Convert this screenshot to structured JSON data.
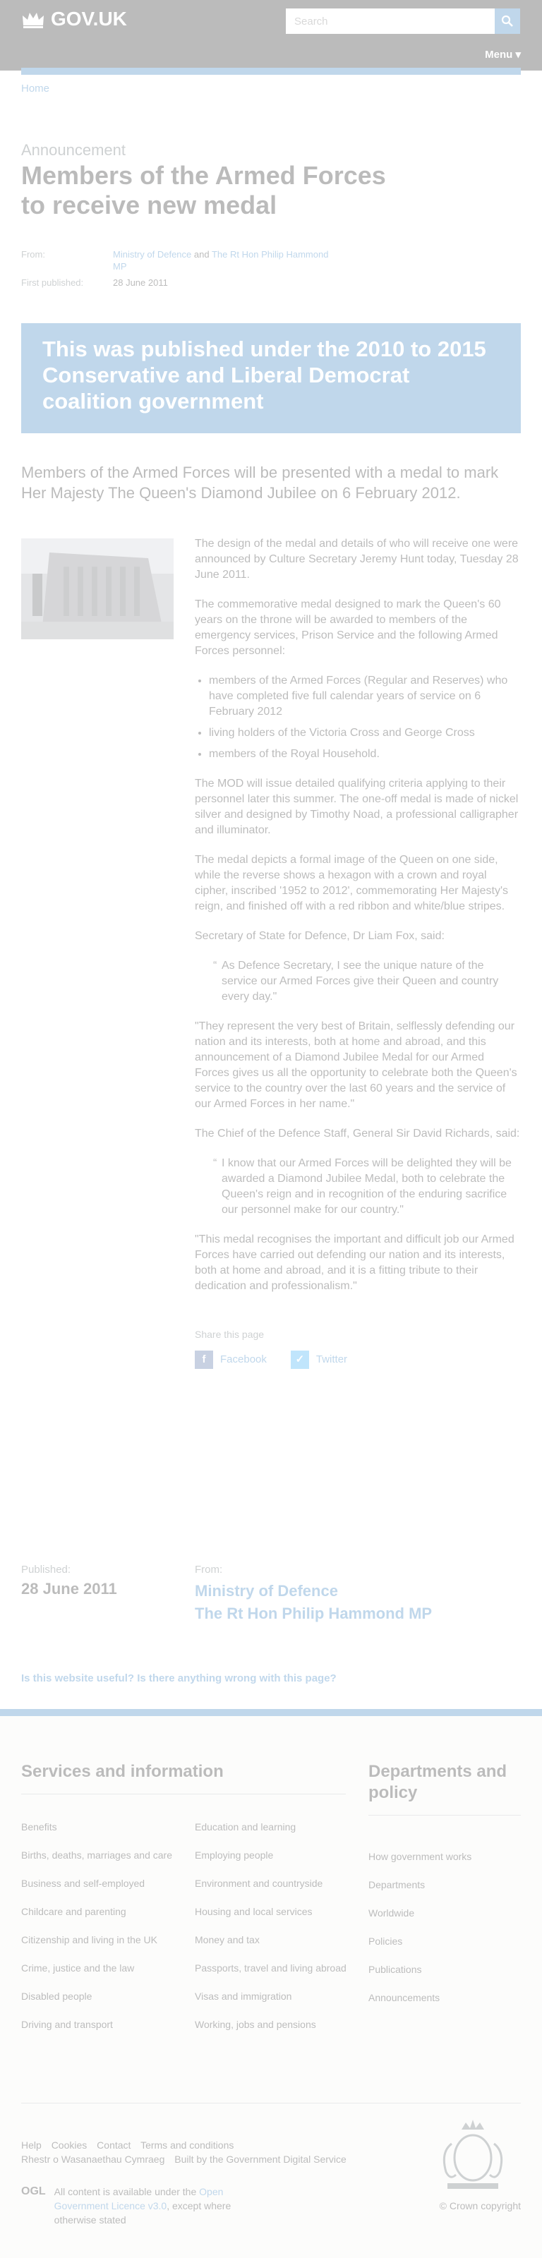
{
  "header": {
    "logo": "GOV.UK",
    "search_placeholder": "Search",
    "menu": "Menu"
  },
  "breadcrumb": {
    "home": "Home"
  },
  "doc": {
    "type": "Announcement",
    "title": "Members of the Armed Forces to receive new medal",
    "from_label": "From:",
    "from_org1": "Ministry of Defence",
    "from_and": "and",
    "from_org2": "The Rt Hon Philip Hammond MP",
    "published_label": "First published:",
    "published_date": "28 June 2011"
  },
  "history": {
    "text": "This was published under the 2010 to 2015 Conservative and Liberal Democrat coalition government"
  },
  "lead": "Members of the Armed Forces will be presented with a medal to mark Her Majesty The Queen's Diamond Jubilee on 6 February 2012.",
  "body": {
    "p1": "The design of the medal and details of who will receive one were announced by Culture Secretary Jeremy Hunt today, Tuesday 28 June 2011.",
    "p2": "The commemorative medal designed to mark the Queen's 60 years on the throne will be awarded to members of the emergency services, Prison Service and the following Armed Forces personnel:",
    "list": [
      "members of the Armed Forces (Regular and Reserves) who have completed five full calendar years of service on 6 February 2012",
      "living holders of the Victoria Cross and George Cross",
      "members of the Royal Household."
    ],
    "p3": "The MOD will issue detailed qualifying criteria applying to their personnel later this summer. The one-off medal is made of nickel silver and designed by Timothy Noad, a professional calligrapher and illuminator.",
    "p4": "The medal depicts a formal image of the Queen on one side, while the reverse shows a hexagon with a crown and royal cipher, inscribed '1952 to 2012', commemorating Her Majesty's reign, and finished off with a red ribbon and white/blue stripes.",
    "p5": "Secretary of State for Defence, Dr Liam Fox, said:",
    "quote1": "As Defence Secretary, I see the unique nature of the service our Armed Forces give their Queen and country every day.\"",
    "p6": "\"They represent the very best of Britain, selflessly defending our nation and its interests, both at home and abroad, and this announcement of a Diamond Jubilee Medal for our Armed Forces gives us all the opportunity to celebrate both the Queen's service to the country over the last 60 years and the service of our Armed Forces in her name.\"",
    "p7": "The Chief of the Defence Staff, General Sir David Richards, said:",
    "quote2": "I know that our Armed Forces will be delighted they will be awarded a Diamond Jubilee Medal, both to celebrate the Queen's reign and in recognition of the enduring sacrifice our personnel make for our country.\"",
    "p8": "\"This medal recognises the important and difficult job our Armed Forces have carried out defending our nation and its interests, both at home and abroad, and it is a fitting tribute to their dedication and professionalism.\"",
    "quote_mark": "“"
  },
  "share": {
    "title": "Share this page",
    "facebook": "Facebook",
    "twitter": "Twitter"
  },
  "published": {
    "label": "Published:",
    "date": "28 June 2011",
    "from_label": "From:",
    "org1": "Ministry of Defence",
    "org2": "The Rt Hon Philip Hammond MP"
  },
  "feedback": "Is this website useful? Is there anything wrong with this page?",
  "footer": {
    "services_heading": "Services and information",
    "services_col1": [
      "Benefits",
      "Births, deaths, marriages and care",
      "Business and self-employed",
      "Childcare and parenting",
      "Citizenship and living in the UK",
      "Crime, justice and the law",
      "Disabled people",
      "Driving and transport"
    ],
    "services_col2": [
      "Education and learning",
      "Employing people",
      "Environment and countryside",
      "Housing and local services",
      "Money and tax",
      "Passports, travel and living abroad",
      "Visas and immigration",
      "Working, jobs and pensions"
    ],
    "depts_heading": "Departments and policy",
    "depts": [
      "How government works",
      "Departments",
      "Worldwide",
      "Policies",
      "Publications",
      "Announcements"
    ],
    "bottom_links": [
      "Help",
      "Cookies",
      "Contact",
      "Terms and conditions"
    ],
    "bottom_links2": [
      "Rhestr o Wasanaethau Cymraeg"
    ],
    "built_by": "Built by the",
    "built_by_link": "Government Digital Service",
    "ogl": "OGL",
    "licence_pre": "All content is available under the",
    "licence_link": "Open Government Licence v3.0",
    "licence_post": ", except where otherwise stated",
    "copyright": "© Crown copyright"
  },
  "colors": {
    "brand_blue": "#1d70b8",
    "header_black": "#0b0c0c",
    "footer_grey": "#f3f2f1"
  }
}
